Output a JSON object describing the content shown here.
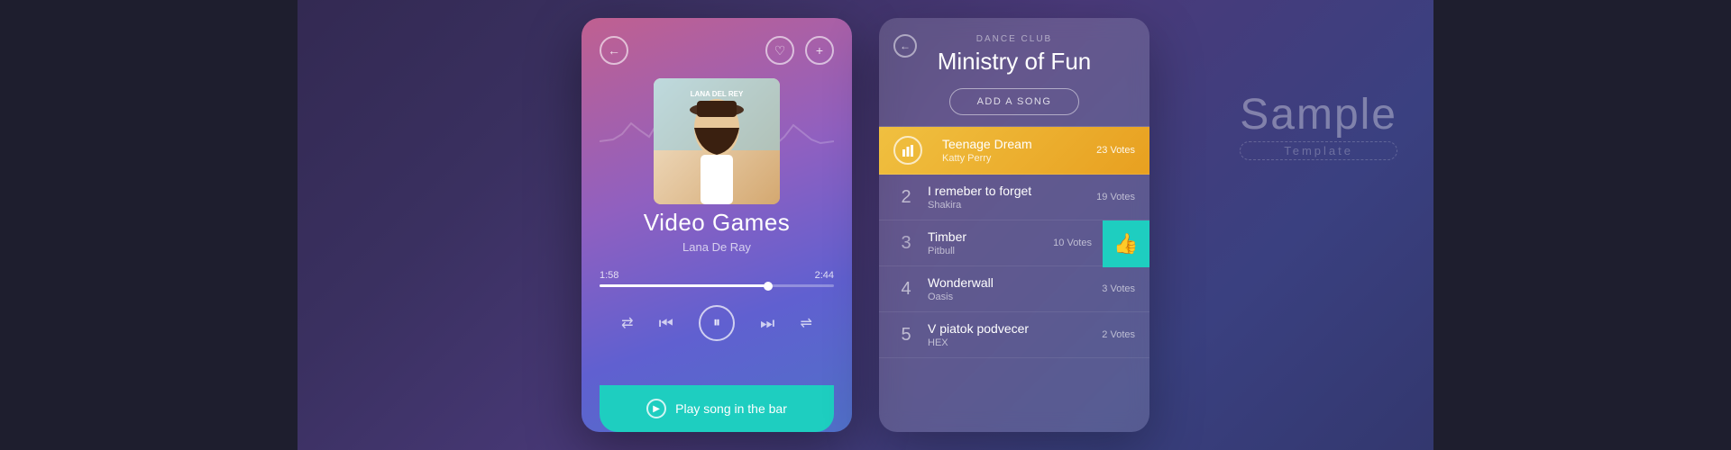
{
  "page": {
    "background": "#2d2447"
  },
  "sample": {
    "title": "Sample",
    "subtitle": "Template"
  },
  "player": {
    "back_label": "←",
    "heart_label": "♡",
    "plus_label": "+",
    "song_title": "Video Games",
    "song_artist": "Lana De Ray",
    "time_current": "1:58",
    "time_total": "2:44",
    "progress_percent": 72,
    "controls": {
      "repeat": "⇄",
      "rewind": "⏮",
      "play_pause": "⏸",
      "forward": "⏭",
      "shuffle": "⇌"
    },
    "play_song_bar_label": "Play song in the bar"
  },
  "club": {
    "back_label": "←",
    "category_label": "DANCE CLUB",
    "name": "Ministry of Fun",
    "add_song_btn": "ADD A SONG",
    "songs": [
      {
        "rank": "1",
        "rank_type": "icon",
        "title": "Teenage Dream",
        "artist": "Katty Perry",
        "votes": "23 Votes",
        "highlighted": true
      },
      {
        "rank": "2",
        "rank_type": "number",
        "title": "I remeber to forget",
        "artist": "Shakira",
        "votes": "19 Votes",
        "highlighted": false
      },
      {
        "rank": "3",
        "rank_type": "number",
        "title": "Timber",
        "artist": "Pitbull",
        "votes": "10 Votes",
        "highlighted": false,
        "voted": true
      },
      {
        "rank": "4",
        "rank_type": "number",
        "title": "Wonderwall",
        "artist": "Oasis",
        "votes": "3 Votes",
        "highlighted": false
      },
      {
        "rank": "5",
        "rank_type": "number",
        "title": "V piatok podvecer",
        "artist": "HEX",
        "votes": "2 Votes",
        "highlighted": false
      }
    ]
  }
}
